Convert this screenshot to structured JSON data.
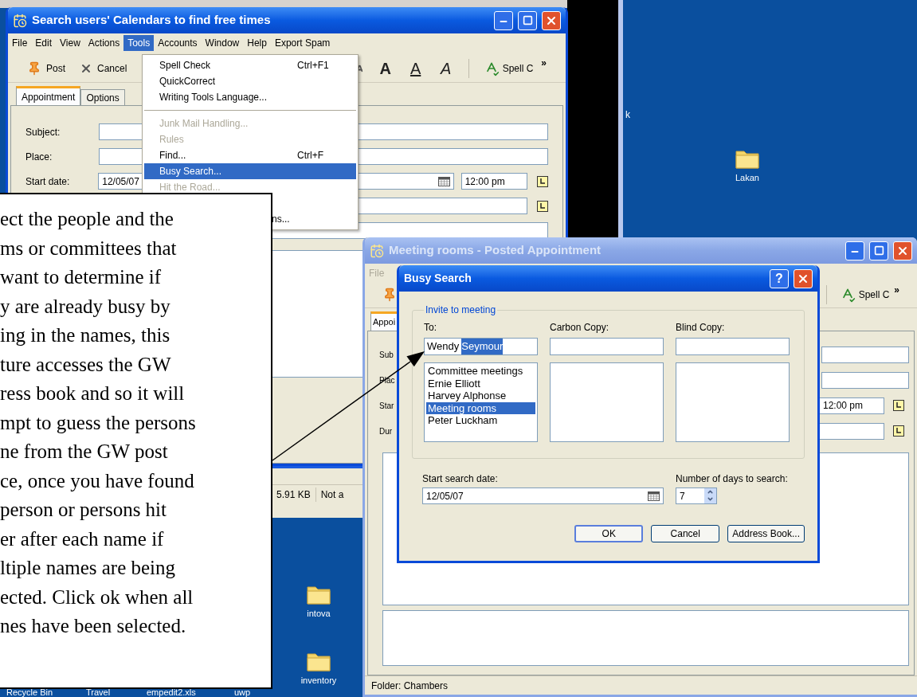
{
  "desktop": {
    "side_text": "k",
    "icons": [
      {
        "label": "Lakan"
      },
      {
        "label": "intova"
      },
      {
        "label": "inventory"
      }
    ],
    "bottom_labels": [
      "Recycle Bin",
      "Travel",
      "empedit2.xls",
      "uwp"
    ]
  },
  "main_window": {
    "title": "Search users' Calendars to find free times",
    "active": true,
    "menu": [
      {
        "label": "File",
        "selected": false
      },
      {
        "label": "Edit",
        "selected": false
      },
      {
        "label": "View",
        "selected": false
      },
      {
        "label": "Actions",
        "selected": false
      },
      {
        "label": "Tools",
        "selected": true
      },
      {
        "label": "Accounts",
        "selected": false
      },
      {
        "label": "Window",
        "selected": false
      },
      {
        "label": "Help",
        "selected": false
      },
      {
        "label": "Export Spam",
        "selected": false
      }
    ],
    "toolbar": [
      {
        "label": "Post",
        "kind": "post"
      },
      {
        "label": "Cancel",
        "kind": "cancel"
      }
    ],
    "format": [
      {
        "label": "A",
        "kind": "bold"
      },
      {
        "label": "A",
        "kind": "underline"
      },
      {
        "label": "A",
        "kind": "italic"
      }
    ],
    "spell": "Spell C",
    "more": "»",
    "tabs": [
      {
        "label": "Appointment",
        "selected": true
      },
      {
        "label": "Options",
        "selected": false
      }
    ],
    "fields": [
      {
        "label": "Subject:"
      },
      {
        "label": "Place:"
      },
      {
        "label": "Start date:",
        "value": "12/05/07",
        "time": "12:00 pm"
      }
    ]
  },
  "tools_menu": [
    {
      "kind": "item",
      "label": "Spell Check",
      "shortcut": "Ctrl+F1",
      "disabled": false,
      "selected": false
    },
    {
      "kind": "item",
      "label": "QuickCorrect",
      "disabled": false,
      "selected": false
    },
    {
      "kind": "item",
      "label": "Writing Tools Language...",
      "disabled": false,
      "selected": false
    },
    {
      "kind": "separator"
    },
    {
      "kind": "item",
      "label": "Junk Mail Handling...",
      "disabled": true,
      "selected": false
    },
    {
      "kind": "item",
      "label": "Rules",
      "disabled": true,
      "selected": false
    },
    {
      "kind": "item",
      "label": "Find...",
      "shortcut": "Ctrl+F",
      "disabled": false,
      "selected": false
    },
    {
      "kind": "item",
      "label": "Busy Search...",
      "disabled": false,
      "selected": true
    },
    {
      "kind": "item",
      "label": "Hit the Road...",
      "disabled": true,
      "selected": false
    },
    {
      "kind": "blank"
    },
    {
      "kind": "clipped",
      "label": "ns...",
      "disabled": false,
      "selected": false
    }
  ],
  "back_window": {
    "status": [
      "5.91 KB",
      "Not a"
    ]
  },
  "appointment_window": {
    "title": "Meeting rooms - Posted Appointment",
    "active": false,
    "menu": [
      "File"
    ],
    "spell": "Spell C",
    "more": "»",
    "tab": {
      "label": "Appoi",
      "selected": true
    },
    "field_labels": [
      "Sub",
      "Plac",
      "Star",
      "Dur"
    ],
    "time": "12:00 pm",
    "status": "Folder: Chambers"
  },
  "busy_search": {
    "title": "Busy Search",
    "help": "?",
    "active": true,
    "group": "Invite to meeting",
    "columns": [
      "To:",
      "Carbon Copy:",
      "Blind Copy:"
    ],
    "to_typed": "Wendy",
    "to_completion": "Seymour",
    "to_list": [
      {
        "label": "Committee meetings",
        "selected": false
      },
      {
        "label": "Ernie Elliott",
        "selected": false
      },
      {
        "label": "Harvey Alphonse",
        "selected": false
      },
      {
        "label": "Meeting rooms",
        "selected": true
      },
      {
        "label": "Peter Luckham",
        "selected": false
      }
    ],
    "start_label": "Start search date:",
    "start_value": "12/05/07",
    "days_label": "Number of days to search:",
    "days_value": "7",
    "buttons": [
      {
        "label": "OK",
        "default": true
      },
      {
        "label": "Cancel",
        "default": false
      },
      {
        "label": "Address Book...",
        "default": false
      }
    ]
  },
  "callout": {
    "lines": [
      "ect the people and the",
      "ms or committees that",
      "want to determine if",
      "y are already busy by",
      "ing in the names, this",
      "ture accesses the GW",
      "ress book and so it will",
      "mpt to guess the persons",
      "ne from the GW post",
      "ce, once you have found",
      "person or persons hit",
      "er after each name if",
      "ltiple names are being",
      "ected. Click ok when all",
      "nes have been selected."
    ]
  }
}
